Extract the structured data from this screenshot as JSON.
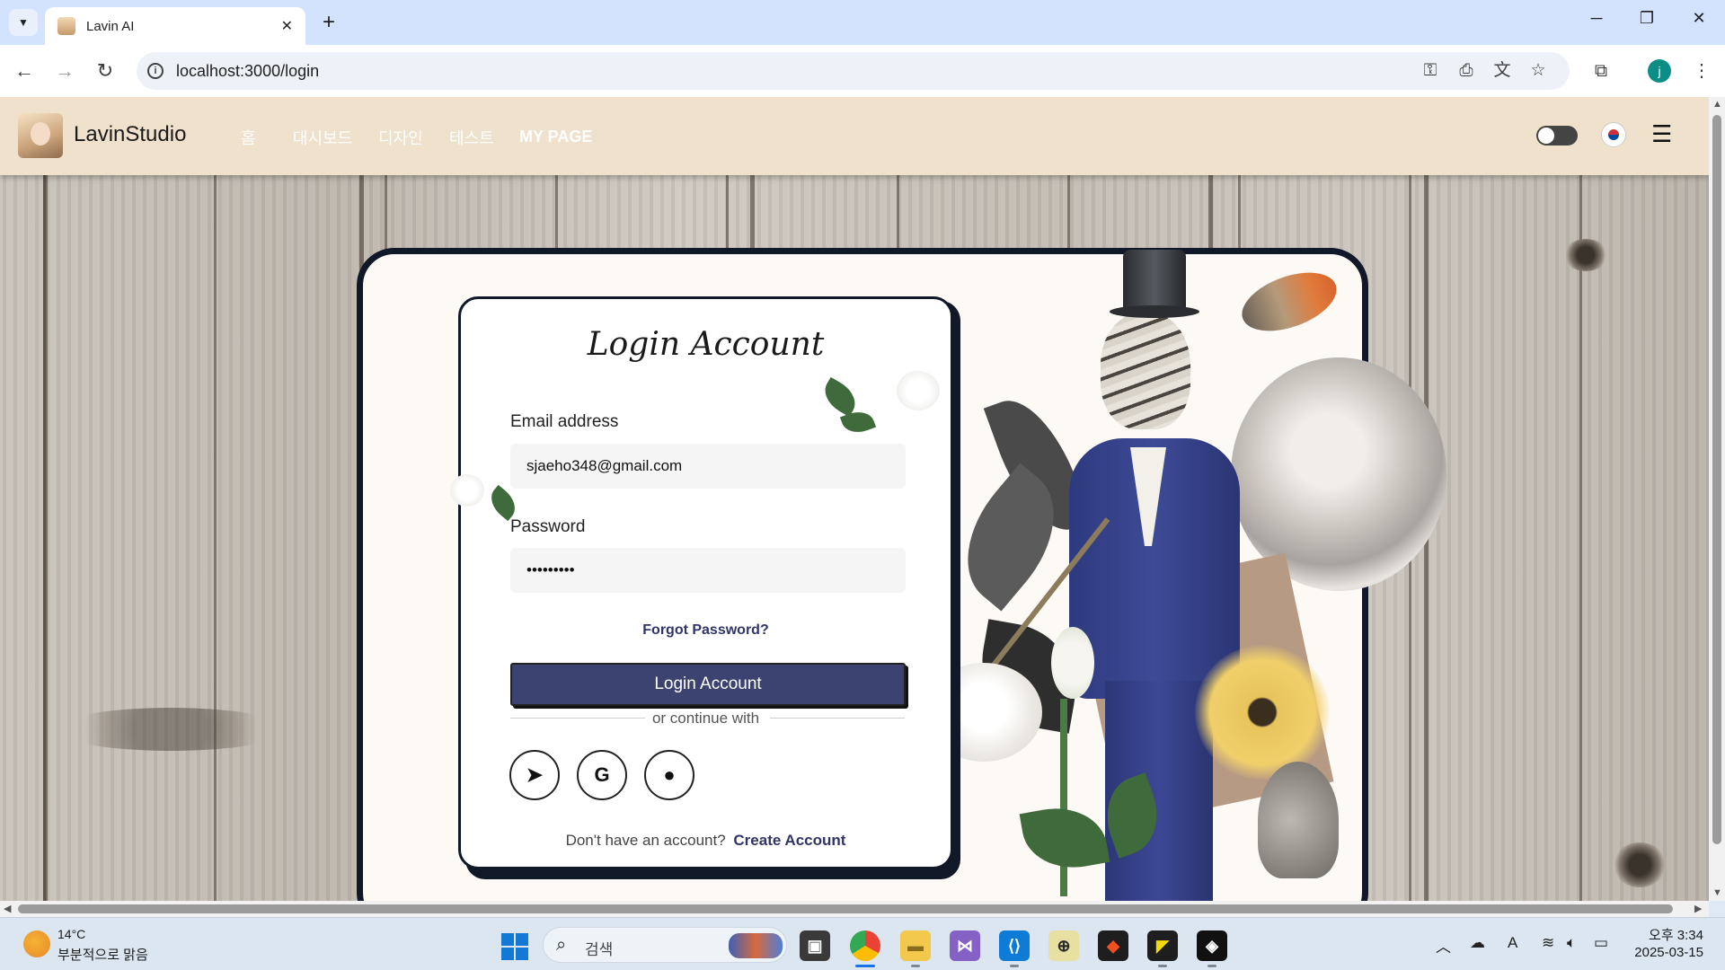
{
  "browser": {
    "tab_title": "Lavin AI",
    "url": "localhost:3000/login",
    "new_tab": "+",
    "profile_initial": "j"
  },
  "header": {
    "brand": "LavinStudio",
    "nav": [
      "홈",
      "대시보드",
      "디자인",
      "테스트",
      "MY PAGE"
    ]
  },
  "login": {
    "title": "Login Account",
    "email_label": "Email address",
    "email_value": "sjaeho348@gmail.com",
    "password_label": "Password",
    "password_value": "•••••••••",
    "forgot": "Forgot Password?",
    "submit": "Login Account",
    "divider": "or continue with",
    "social": [
      "telegram-icon",
      "google-icon",
      "apple-icon"
    ],
    "signup_prompt": "Don't have an account?",
    "signup_link": "Create Account"
  },
  "taskbar": {
    "temperature": "14°C",
    "weather": "부분적으로 맑음",
    "search_placeholder": "검색",
    "time": "오후 3:34",
    "date": "2025-03-15"
  },
  "colors": {
    "header_bg": "#efe1cb",
    "button_bg": "#3d4370",
    "link": "#2f3566",
    "frame": "#111827"
  }
}
